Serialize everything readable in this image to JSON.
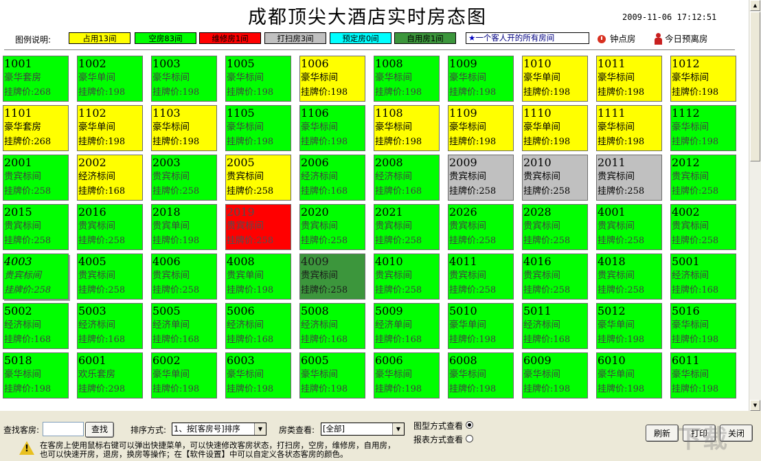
{
  "title": "成都顶尖大酒店实时房态图",
  "datetime": "2009-11-06  17:12:51",
  "legend": {
    "label": "图例说明:",
    "items": [
      {
        "key": "occ",
        "label": "占用13间",
        "color": "#ffff00"
      },
      {
        "key": "empty",
        "label": "空房83间",
        "color": "#00ff00"
      },
      {
        "key": "repair",
        "label": "维修房1间",
        "color": "#ff0000"
      },
      {
        "key": "clean",
        "label": "打扫房3间",
        "color": "#c0c0c0"
      },
      {
        "key": "reserved",
        "label": "预定房0间",
        "color": "#00ffff"
      },
      {
        "key": "self",
        "label": "自用房1间",
        "color": "#3c963c"
      }
    ],
    "same_guest_star": "★",
    "same_guest": "一个客人开的所有房间",
    "hourly_room": "钟点房",
    "departing_today": "今日预离房"
  },
  "rooms": [
    {
      "num": "1001",
      "type": "豪华套房",
      "price": "挂牌价:268",
      "status": "empty"
    },
    {
      "num": "1002",
      "type": "豪华单间",
      "price": "挂牌价:198",
      "status": "empty"
    },
    {
      "num": "1003",
      "type": "豪华标间",
      "price": "挂牌价:198",
      "status": "empty"
    },
    {
      "num": "1005",
      "type": "豪华标间",
      "price": "挂牌价:198",
      "status": "empty"
    },
    {
      "num": "1006",
      "type": "豪华标间",
      "price": "挂牌价:198",
      "status": "occ"
    },
    {
      "num": "1008",
      "type": "豪华标间",
      "price": "挂牌价:198",
      "status": "empty"
    },
    {
      "num": "1009",
      "type": "豪华标间",
      "price": "挂牌价:198",
      "status": "empty"
    },
    {
      "num": "1010",
      "type": "豪华单间",
      "price": "挂牌价:198",
      "status": "occ"
    },
    {
      "num": "1011",
      "type": "豪华标间",
      "price": "挂牌价:198",
      "status": "occ"
    },
    {
      "num": "1012",
      "type": "豪华标间",
      "price": "挂牌价:198",
      "status": "occ"
    },
    {
      "num": "1101",
      "type": "豪华套房",
      "price": "挂牌价:268",
      "status": "occ"
    },
    {
      "num": "1102",
      "type": "豪华单间",
      "price": "挂牌价:198",
      "status": "occ"
    },
    {
      "num": "1103",
      "type": "豪华标间",
      "price": "挂牌价:198",
      "status": "occ"
    },
    {
      "num": "1105",
      "type": "豪华标间",
      "price": "挂牌价:198",
      "status": "empty"
    },
    {
      "num": "1106",
      "type": "豪华标间",
      "price": "挂牌价:198",
      "status": "empty"
    },
    {
      "num": "1108",
      "type": "豪华标间",
      "price": "挂牌价:198",
      "status": "occ"
    },
    {
      "num": "1109",
      "type": "豪华标间",
      "price": "挂牌价:198",
      "status": "occ"
    },
    {
      "num": "1110",
      "type": "豪华单间",
      "price": "挂牌价:198",
      "status": "occ"
    },
    {
      "num": "1111",
      "type": "豪华标间",
      "price": "挂牌价:198",
      "status": "occ"
    },
    {
      "num": "1112",
      "type": "豪华标间",
      "price": "挂牌价:198",
      "status": "empty"
    },
    {
      "num": "2001",
      "type": "贵宾标间",
      "price": "挂牌价:258",
      "status": "empty"
    },
    {
      "num": "2002",
      "type": "经济标间",
      "price": "挂牌价:168",
      "status": "occ"
    },
    {
      "num": "2003",
      "type": "贵宾标间",
      "price": "挂牌价:258",
      "status": "empty"
    },
    {
      "num": "2005",
      "type": "贵宾标间",
      "price": "挂牌价:258",
      "status": "occ"
    },
    {
      "num": "2006",
      "type": "经济标间",
      "price": "挂牌价:168",
      "status": "empty"
    },
    {
      "num": "2008",
      "type": "经济标间",
      "price": "挂牌价:168",
      "status": "empty"
    },
    {
      "num": "2009",
      "type": "贵宾标间",
      "price": "挂牌价:258",
      "status": "clean"
    },
    {
      "num": "2010",
      "type": "贵宾标间",
      "price": "挂牌价:258",
      "status": "clean"
    },
    {
      "num": "2011",
      "type": "贵宾标间",
      "price": "挂牌价:258",
      "status": "clean"
    },
    {
      "num": "2012",
      "type": "贵宾标间",
      "price": "挂牌价:258",
      "status": "empty"
    },
    {
      "num": "2015",
      "type": "贵宾标间",
      "price": "挂牌价:258",
      "status": "empty"
    },
    {
      "num": "2016",
      "type": "贵宾标间",
      "price": "挂牌价:258",
      "status": "empty"
    },
    {
      "num": "2018",
      "type": "贵宾单间",
      "price": "挂牌价:198",
      "status": "empty"
    },
    {
      "num": "2019",
      "type": "贵宾标间",
      "price": "挂牌价:258",
      "status": "repair"
    },
    {
      "num": "2020",
      "type": "贵宾标间",
      "price": "挂牌价:258",
      "status": "empty"
    },
    {
      "num": "2021",
      "type": "贵宾标间",
      "price": "挂牌价:258",
      "status": "empty"
    },
    {
      "num": "2026",
      "type": "贵宾标间",
      "price": "挂牌价:258",
      "status": "empty"
    },
    {
      "num": "2028",
      "type": "贵宾标间",
      "price": "挂牌价:258",
      "status": "empty"
    },
    {
      "num": "4001",
      "type": "贵宾标间",
      "price": "挂牌价:258",
      "status": "empty"
    },
    {
      "num": "4002",
      "type": "贵宾标间",
      "price": "挂牌价:258",
      "status": "empty"
    },
    {
      "num": "4003",
      "type": "贵宾标间",
      "price": "挂牌价:258",
      "status": "empty",
      "italic": true
    },
    {
      "num": "4005",
      "type": "贵宾标间",
      "price": "挂牌价:258",
      "status": "empty"
    },
    {
      "num": "4006",
      "type": "贵宾标间",
      "price": "挂牌价:258",
      "status": "empty"
    },
    {
      "num": "4008",
      "type": "贵宾单间",
      "price": "挂牌价:198",
      "status": "empty"
    },
    {
      "num": "4009",
      "type": "贵宾标间",
      "price": "挂牌价:258",
      "status": "self"
    },
    {
      "num": "4010",
      "type": "贵宾标间",
      "price": "挂牌价:258",
      "status": "empty"
    },
    {
      "num": "4011",
      "type": "贵宾标间",
      "price": "挂牌价:258",
      "status": "empty"
    },
    {
      "num": "4016",
      "type": "贵宾标间",
      "price": "挂牌价:258",
      "status": "empty"
    },
    {
      "num": "4018",
      "type": "贵宾标间",
      "price": "挂牌价:258",
      "status": "empty"
    },
    {
      "num": "5001",
      "type": "经济标间",
      "price": "挂牌价:168",
      "status": "empty"
    },
    {
      "num": "5002",
      "type": "经济标间",
      "price": "挂牌价:168",
      "status": "empty"
    },
    {
      "num": "5003",
      "type": "经济标间",
      "price": "挂牌价:168",
      "status": "empty"
    },
    {
      "num": "5005",
      "type": "经济单间",
      "price": "挂牌价:168",
      "status": "empty"
    },
    {
      "num": "5006",
      "type": "经济标间",
      "price": "挂牌价:168",
      "status": "empty"
    },
    {
      "num": "5008",
      "type": "经济标间",
      "price": "挂牌价:168",
      "status": "empty"
    },
    {
      "num": "5009",
      "type": "经济单间",
      "price": "挂牌价:168",
      "status": "empty"
    },
    {
      "num": "5010",
      "type": "豪华单间",
      "price": "挂牌价:198",
      "status": "empty"
    },
    {
      "num": "5011",
      "type": "经济标间",
      "price": "挂牌价:168",
      "status": "empty"
    },
    {
      "num": "5012",
      "type": "豪华单间",
      "price": "挂牌价:198",
      "status": "empty"
    },
    {
      "num": "5016",
      "type": "豪华标间",
      "price": "挂牌价:198",
      "status": "empty"
    },
    {
      "num": "5018",
      "type": "豪华标间",
      "price": "挂牌价:198",
      "status": "empty"
    },
    {
      "num": "6001",
      "type": "欢乐套房",
      "price": "挂牌价:298",
      "status": "empty"
    },
    {
      "num": "6002",
      "type": "豪华单间",
      "price": "挂牌价:198",
      "status": "empty"
    },
    {
      "num": "6003",
      "type": "豪华标间",
      "price": "挂牌价:198",
      "status": "empty"
    },
    {
      "num": "6005",
      "type": "豪华标间",
      "price": "挂牌价:198",
      "status": "empty"
    },
    {
      "num": "6006",
      "type": "豪华标间",
      "price": "挂牌价:198",
      "status": "empty"
    },
    {
      "num": "6008",
      "type": "豪华标间",
      "price": "挂牌价:198",
      "status": "empty"
    },
    {
      "num": "6009",
      "type": "豪华标间",
      "price": "挂牌价:198",
      "status": "empty"
    },
    {
      "num": "6010",
      "type": "豪华单间",
      "price": "挂牌价:198",
      "status": "empty"
    },
    {
      "num": "6011",
      "type": "豪华标间",
      "price": "挂牌价:198",
      "status": "empty"
    }
  ],
  "scrollbar": {
    "up": "▲",
    "down": "▼"
  },
  "bottom": {
    "search_label": "查找客房:",
    "search_value": "",
    "search_button": "查找",
    "sort_label": "排序方式:",
    "sort_value": "1、按[客房号]排序",
    "type_label": "房类查看:",
    "type_value": "[全部]",
    "dropdown_arrow": "▼",
    "view_graph": "图型方式查看",
    "view_report": "报表方式查看",
    "refresh": "刷新",
    "print": "打印",
    "close": "关闭",
    "hint_line1": "在客房上使用鼠标右键可以弹出快捷菜单，可以快速修改客房状态，打扫房，空房，维修房，自用房，",
    "hint_line2": "也可以快速开房，退房，换房等操作；在【软件设置】中可以自定义各状态客房的颜色。"
  },
  "watermark": "下载"
}
